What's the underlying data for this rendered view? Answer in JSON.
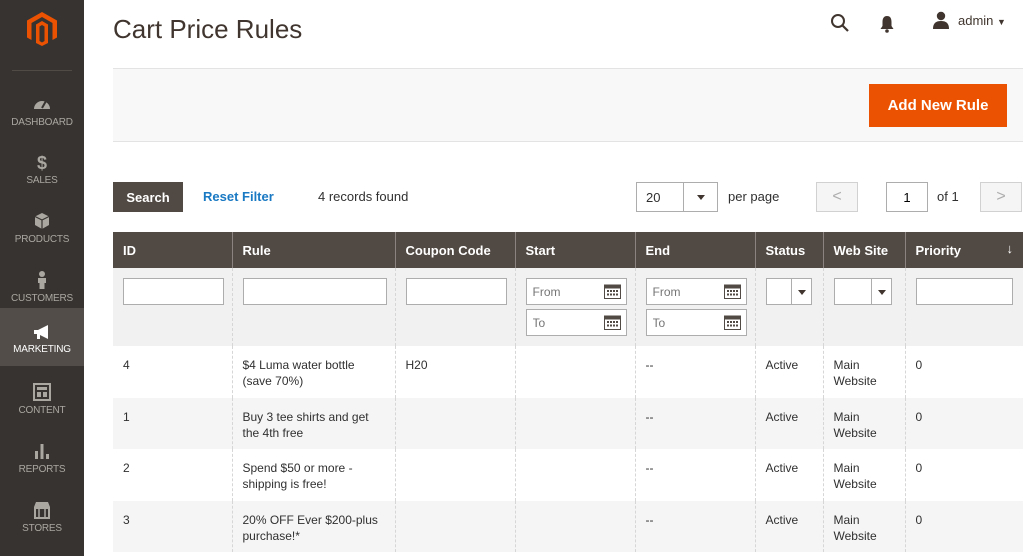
{
  "sidebar": {
    "items": [
      {
        "label": "DASHBOARD",
        "icon": "gauge-icon"
      },
      {
        "label": "SALES",
        "icon": "dollar-icon"
      },
      {
        "label": "PRODUCTS",
        "icon": "cube-icon"
      },
      {
        "label": "CUSTOMERS",
        "icon": "person-icon"
      },
      {
        "label": "MARKETING",
        "icon": "megaphone-icon"
      },
      {
        "label": "CONTENT",
        "icon": "layout-icon"
      },
      {
        "label": "REPORTS",
        "icon": "bar-chart-icon"
      },
      {
        "label": "STORES",
        "icon": "storefront-icon"
      }
    ],
    "active": "MARKETING"
  },
  "header": {
    "title": "Cart Price Rules",
    "user": "admin"
  },
  "actions": {
    "add_label": "Add New Rule"
  },
  "toolbar": {
    "search_label": "Search",
    "reset_label": "Reset Filter",
    "records_found": "4 records found",
    "per_page_value": "20",
    "per_page_label": "per page",
    "prev": "<",
    "next": ">",
    "page": "1",
    "page_of": "of 1"
  },
  "grid": {
    "columns": [
      "ID",
      "Rule",
      "Coupon Code",
      "Start",
      "End",
      "Status",
      "Web Site",
      "Priority"
    ],
    "sort_indicator": "↓",
    "filters": {
      "from_placeholder": "From",
      "to_placeholder": "To"
    },
    "rows": [
      {
        "id": "4",
        "rule": "$4 Luma water bottle (save 70%)",
        "coupon": "H20",
        "start": "",
        "end": "--",
        "status": "Active",
        "website": "Main Website",
        "priority": "0"
      },
      {
        "id": "1",
        "rule": "Buy 3 tee shirts and get the 4th free",
        "coupon": "",
        "start": "",
        "end": "--",
        "status": "Active",
        "website": "Main Website",
        "priority": "0"
      },
      {
        "id": "2",
        "rule": "Spend $50 or more - shipping is free!",
        "coupon": "",
        "start": "",
        "end": "--",
        "status": "Active",
        "website": "Main Website",
        "priority": "0"
      },
      {
        "id": "3",
        "rule": "20% OFF Ever $200-plus purchase!*",
        "coupon": "",
        "start": "",
        "end": "--",
        "status": "Active",
        "website": "Main Website",
        "priority": "0"
      }
    ]
  },
  "colors": {
    "sidebar_bg": "#373330",
    "accent": "#eb5202",
    "header_bg": "#514943",
    "link": "#1979c3"
  }
}
